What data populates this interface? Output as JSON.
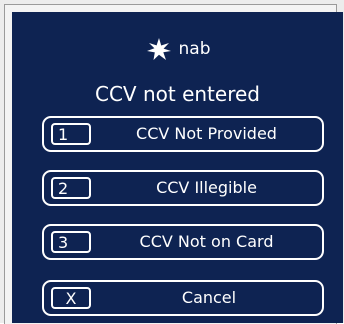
{
  "brand": {
    "name": "nab",
    "logo_icon": "star-icon"
  },
  "dialog": {
    "title": "CCV not entered"
  },
  "options": [
    {
      "key": "1",
      "label": "CCV Not Provided"
    },
    {
      "key": "2",
      "label": "CCV Illegible"
    },
    {
      "key": "3",
      "label": "CCV Not on Card"
    }
  ],
  "cancel": {
    "key": "X",
    "label": "Cancel"
  },
  "colors": {
    "panel_background": "#0e2352",
    "text": "#ffffff"
  }
}
